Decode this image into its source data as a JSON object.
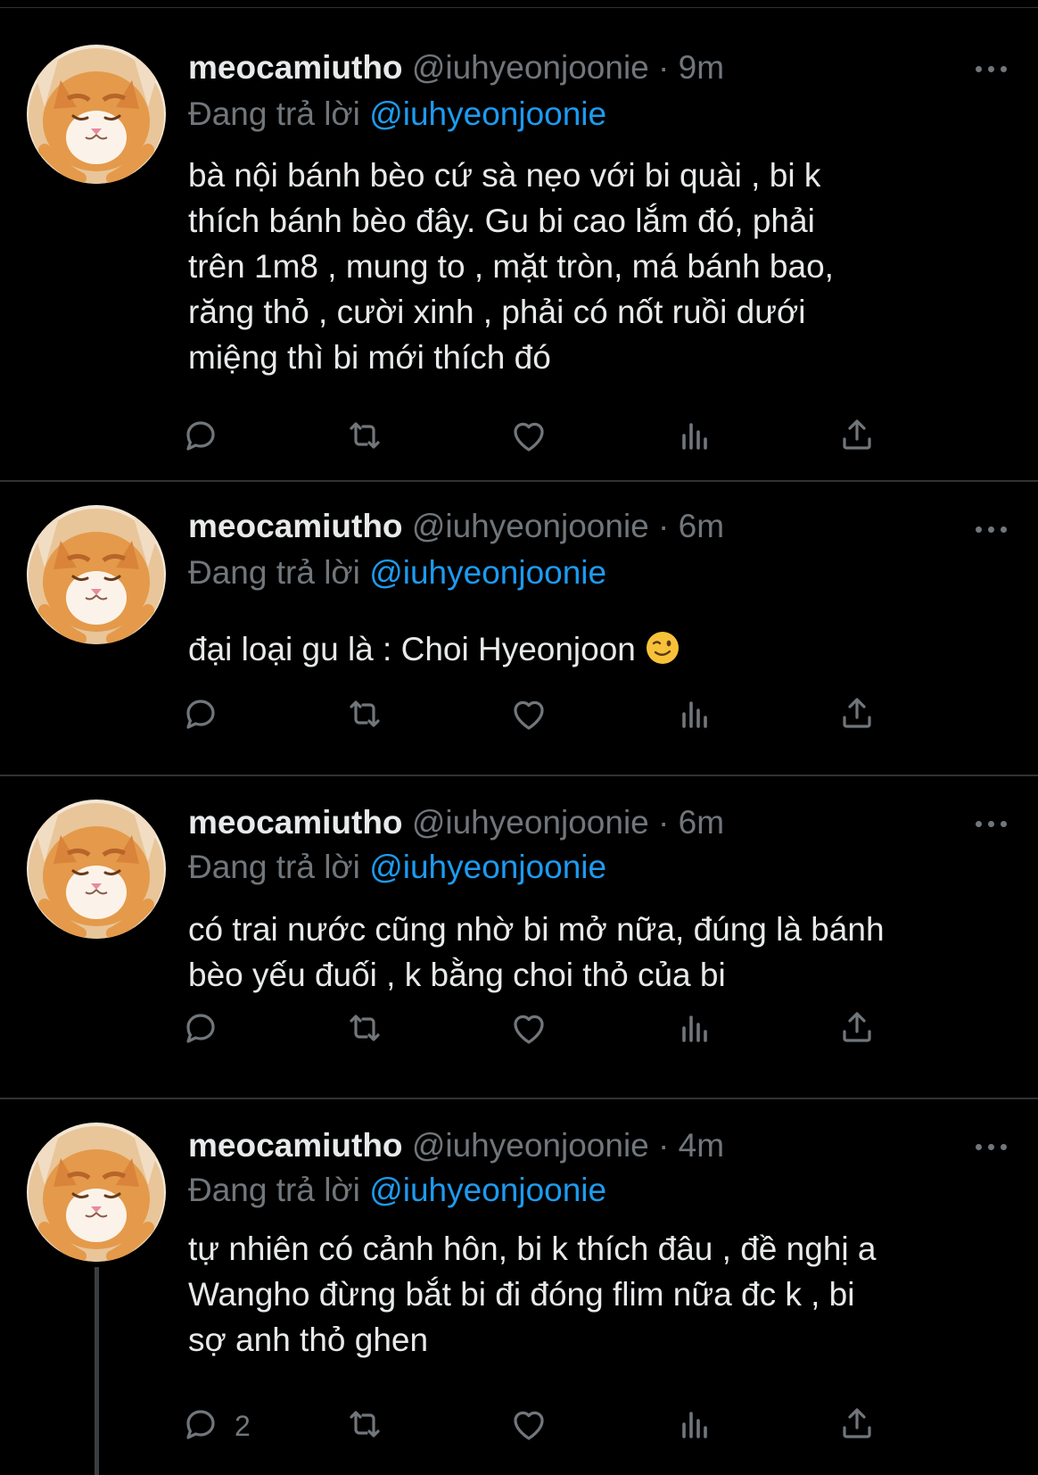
{
  "tweets": [
    {
      "name": "meocamiutho",
      "handle": "@iuhyeonjoonie",
      "dot": "·",
      "time": "9m",
      "reply_prefix": "Đang trả lời",
      "reply_to": "@iuhyeonjoonie",
      "lines": [
        "bà nội bánh bèo cứ sà nẹo với bi quài , bi k",
        "thích bánh bèo đây. Gu bi cao lắm đó, phải",
        "trên 1m8 , mung to , mặt tròn, má bánh bao,",
        "răng thỏ , cười xinh , phải có nốt ruồi dưới",
        "miệng thì bi mới thích đó"
      ],
      "reply_count": ""
    },
    {
      "name": "meocamiutho",
      "handle": "@iuhyeonjoonie",
      "dot": "·",
      "time": "6m",
      "reply_prefix": "Đang trả lời",
      "reply_to": "@iuhyeonjoonie",
      "lines": [
        "đại loại gu là : Choi Hyeonjoon"
      ],
      "emoji": "winking-face",
      "reply_count": ""
    },
    {
      "name": "meocamiutho",
      "handle": "@iuhyeonjoonie",
      "dot": "·",
      "time": "6m",
      "reply_prefix": "Đang trả lời",
      "reply_to": "@iuhyeonjoonie",
      "lines": [
        "có trai nước cũng nhờ bi mở nữa, đúng là bánh",
        "bèo yếu đuối , k bằng choi thỏ của bi"
      ],
      "reply_count": ""
    },
    {
      "name": "meocamiutho",
      "handle": "@iuhyeonjoonie",
      "dot": "·",
      "time": "4m",
      "reply_prefix": "Đang trả lời",
      "reply_to": "@iuhyeonjoonie",
      "lines": [
        "tự nhiên có cảnh hôn, bi k thích đâu , đề nghị a",
        "Wangho đừng bắt bi đi đóng flim nữa đc k , bi",
        "sợ anh thỏ ghen"
      ],
      "reply_count": "2"
    }
  ],
  "icons": [
    "reply-icon",
    "retweet-icon",
    "like-icon",
    "views-icon",
    "share-icon",
    "more-icon"
  ],
  "colors": {
    "background": "#000000",
    "text": "#e7e9ea",
    "muted": "#71767b",
    "mention": "#1d9bf0",
    "divider": "#2f3336"
  }
}
